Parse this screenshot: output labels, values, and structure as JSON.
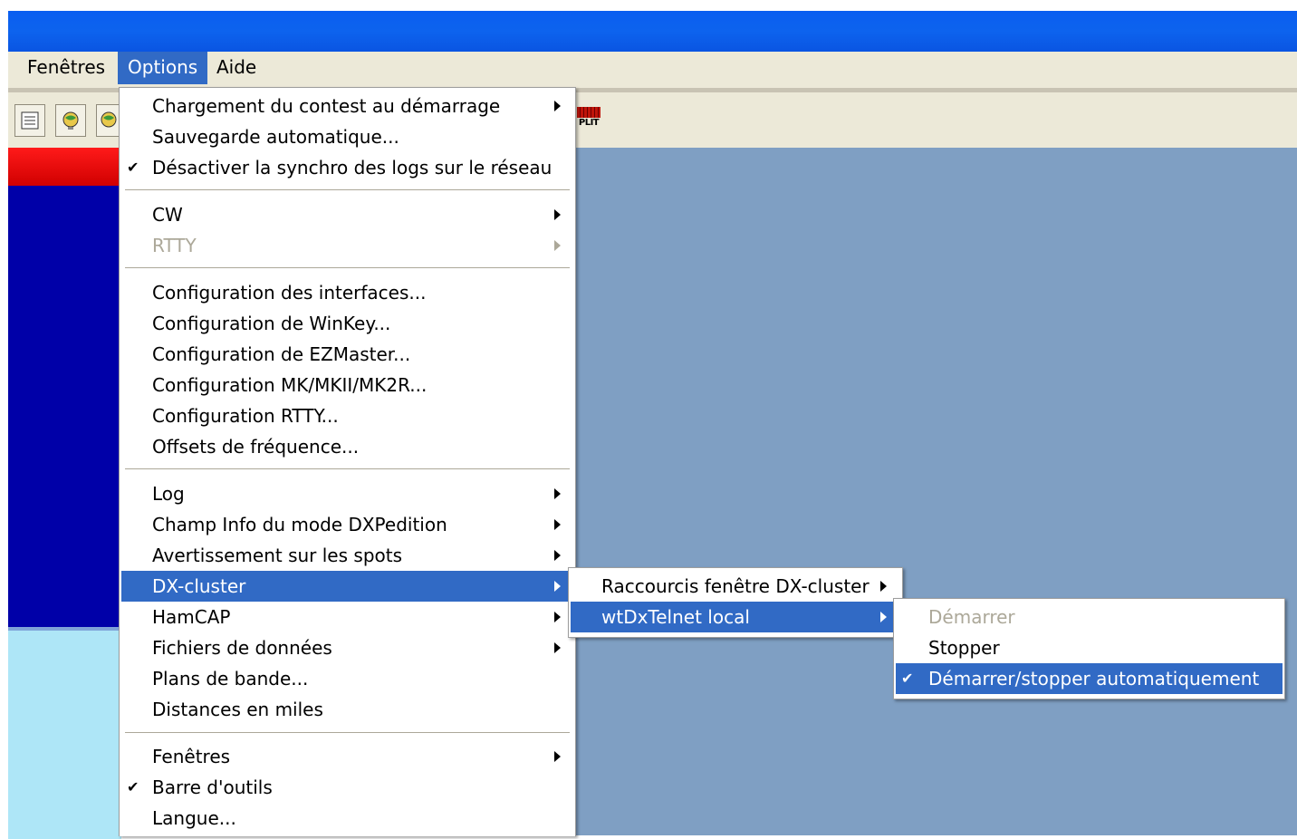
{
  "menubar": {
    "items": [
      "Fenêtres",
      "Options",
      "Aide"
    ]
  },
  "toolbar": {
    "split_label": "PLIT"
  },
  "options_menu": {
    "group1": [
      {
        "label": "Chargement du contest au démarrage",
        "submenu": true,
        "checked": false
      },
      {
        "label": "Sauvegarde automatique...",
        "submenu": false,
        "checked": false
      },
      {
        "label": "Désactiver la synchro des logs sur le réseau",
        "submenu": false,
        "checked": true
      }
    ],
    "group2": [
      {
        "label": "CW",
        "submenu": true
      },
      {
        "label": "RTTY",
        "submenu": true,
        "disabled": true
      }
    ],
    "group3": [
      {
        "label": "Configuration des interfaces..."
      },
      {
        "label": "Configuration de WinKey..."
      },
      {
        "label": "Configuration de EZMaster..."
      },
      {
        "label": "Configuration MK/MKII/MK2R..."
      },
      {
        "label": "Configuration RTTY..."
      },
      {
        "label": "Offsets de fréquence..."
      }
    ],
    "group4": [
      {
        "label": "Log",
        "submenu": true
      },
      {
        "label": "Champ Info du mode DXPedition",
        "submenu": true
      },
      {
        "label": "Avertissement sur les spots",
        "submenu": true
      },
      {
        "label": "DX-cluster",
        "submenu": true,
        "highlighted": true
      },
      {
        "label": "HamCAP",
        "submenu": true
      },
      {
        "label": "Fichiers de données",
        "submenu": true
      },
      {
        "label": "Plans de bande..."
      },
      {
        "label": "Distances en miles"
      }
    ],
    "group5": [
      {
        "label": "Fenêtres",
        "submenu": true
      },
      {
        "label": "Barre d'outils",
        "checked": true
      },
      {
        "label": "Langue..."
      }
    ]
  },
  "dxcluster_submenu": {
    "items": [
      {
        "label": "Raccourcis fenêtre DX-cluster",
        "submenu": true
      },
      {
        "label": "wtDxTelnet local",
        "submenu": true,
        "highlighted": true
      }
    ]
  },
  "telnet_submenu": {
    "items": [
      {
        "label": "Démarrer",
        "disabled": true
      },
      {
        "label": "Stopper"
      },
      {
        "label": "Démarrer/stopper automatiquement",
        "checked": true,
        "highlighted": true
      }
    ]
  },
  "glyphs": {
    "check": "✔"
  },
  "colors": {
    "highlight": "#316ac5",
    "workarea": "#7f9fc3",
    "titlebar": "#0a5ef0"
  }
}
